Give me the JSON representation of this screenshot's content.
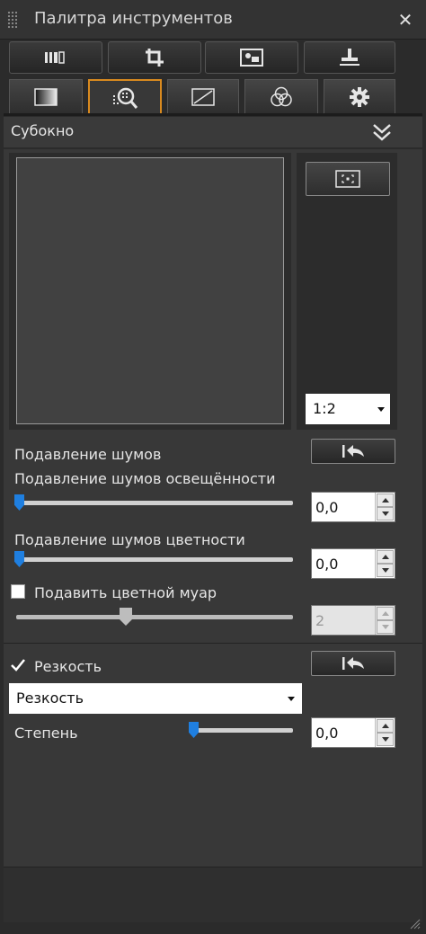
{
  "window": {
    "title": "Палитра инструментов"
  },
  "toolbar": {
    "buttons": [
      "adjust-icon",
      "crop-icon",
      "image-icon",
      "stamp-icon"
    ]
  },
  "tabs": [
    {
      "icon": "exposure-icon",
      "active": false
    },
    {
      "icon": "detail-zoom-icon",
      "active": true
    },
    {
      "icon": "curve-icon",
      "active": false
    },
    {
      "icon": "color-circles-icon",
      "active": false
    },
    {
      "icon": "gear-icon",
      "active": false
    }
  ],
  "section": {
    "title": "Субокно"
  },
  "preview": {
    "zoom": "1:2"
  },
  "noise": {
    "title": "Подавление шумов",
    "luminance_label": "Подавление шумов освещённости",
    "luminance_value": "0,0",
    "chroma_label": "Подавление шумов цветности",
    "chroma_value": "0,0",
    "moire_label": "Подавить цветной муар",
    "moire_checked": false,
    "moire_value": "2"
  },
  "sharpness": {
    "checkbox_label": "Резкость",
    "checked": true,
    "mode": "Резкость",
    "amount_label": "Степень",
    "amount_value": "0,0"
  },
  "colors": {
    "accent": "#d98a1f",
    "slider_thumb": "#1f7fe0"
  }
}
